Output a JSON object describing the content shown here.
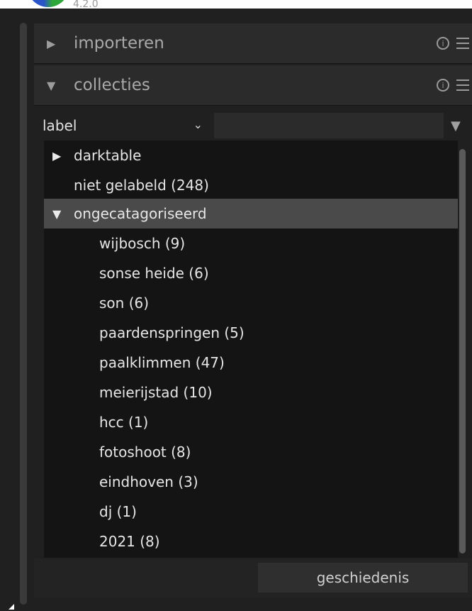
{
  "app": {
    "version": "4.2.0"
  },
  "modules": [
    {
      "title": "importeren",
      "expanded": false
    },
    {
      "title": "collecties",
      "expanded": true
    }
  ],
  "icons": {
    "collapsed_arrow": "▶",
    "expanded_arrow": "▼",
    "info": "i",
    "chevron_down": "⌄",
    "dropdown": "▼"
  },
  "filter": {
    "property": "label",
    "search_value": ""
  },
  "tree": {
    "items": [
      {
        "label": "darktable",
        "type": "group",
        "expanded": false
      },
      {
        "label": "niet gelabeld (248)",
        "type": "leaf"
      },
      {
        "label": "ongecatagoriseerd",
        "type": "group",
        "expanded": true,
        "selected": true
      },
      {
        "label": "wijbosch (9)",
        "type": "child"
      },
      {
        "label": "sonse heide (6)",
        "type": "child"
      },
      {
        "label": "son (6)",
        "type": "child"
      },
      {
        "label": "paardenspringen (5)",
        "type": "child"
      },
      {
        "label": "paalklimmen (47)",
        "type": "child"
      },
      {
        "label": "meierijstad (10)",
        "type": "child"
      },
      {
        "label": "hcc (1)",
        "type": "child"
      },
      {
        "label": "fotoshoot (8)",
        "type": "child"
      },
      {
        "label": "eindhoven (3)",
        "type": "child"
      },
      {
        "label": "dj (1)",
        "type": "child"
      },
      {
        "label": "2021 (8)",
        "type": "child"
      }
    ]
  },
  "buttons": {
    "history": "geschiedenis"
  },
  "colors": {
    "background": "#202020",
    "tree_background": "#141414",
    "selected_row": "#4a4a4a",
    "text": "#e6e6e6"
  }
}
